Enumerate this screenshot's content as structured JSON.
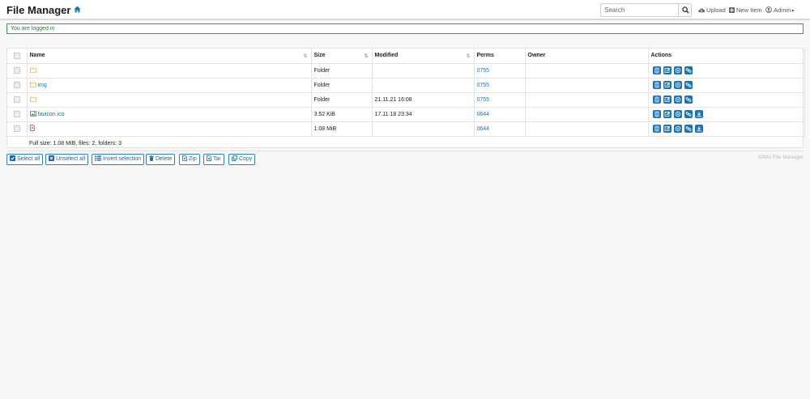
{
  "header": {
    "title": "File Manager",
    "search": {
      "placeholder": "Search",
      "value": ""
    },
    "upload_label": "Upload",
    "new_item_label": "New Item",
    "user_label": "Admin"
  },
  "alert": {
    "message": "You are logged in"
  },
  "table": {
    "columns": {
      "name": "Name",
      "size": "Size",
      "modified": "Modified",
      "perms": "Perms",
      "owner": "Owner",
      "actions": "Actions"
    },
    "rows": [
      {
        "icon": "folder-icon",
        "name": "",
        "size": "Folder",
        "modified": "",
        "perms": "0755",
        "owner": "",
        "download": false
      },
      {
        "icon": "folder-icon",
        "name": "img",
        "size": "Folder",
        "modified": "",
        "perms": "0755",
        "owner": "",
        "download": false
      },
      {
        "icon": "folder-icon",
        "name": "",
        "size": "Folder",
        "modified": "21.11.21 16:08",
        "perms": "0755",
        "owner": "",
        "download": false
      },
      {
        "icon": "image-file-icon",
        "name": "favicon.ico",
        "size": "3.52 KiB",
        "modified": "17.11.18 23:34",
        "perms": "0644",
        "owner": "",
        "download": true
      },
      {
        "icon": "pdf-file-icon",
        "name": "",
        "size": "1.08 MiB",
        "modified": "",
        "perms": "0644",
        "owner": "",
        "download": true
      }
    ],
    "summary": "Full size: 1.08 MiB, files: 2, folders: 3"
  },
  "bulk_actions": {
    "select_all": "Select all",
    "unselect_all": "Unselect all",
    "invert_selection": "Invert selection",
    "delete": "Delete",
    "zip": "Zip",
    "tar": "Tar",
    "copy": "Copy"
  },
  "footer": {
    "brand": "SIMG File Manager"
  },
  "colors": {
    "accent": "#0b72c9",
    "action_icon_bg": "#1b73b7",
    "alert_border": "#28a745",
    "folder": "#e9a93a",
    "pdf": "#d9534f"
  }
}
